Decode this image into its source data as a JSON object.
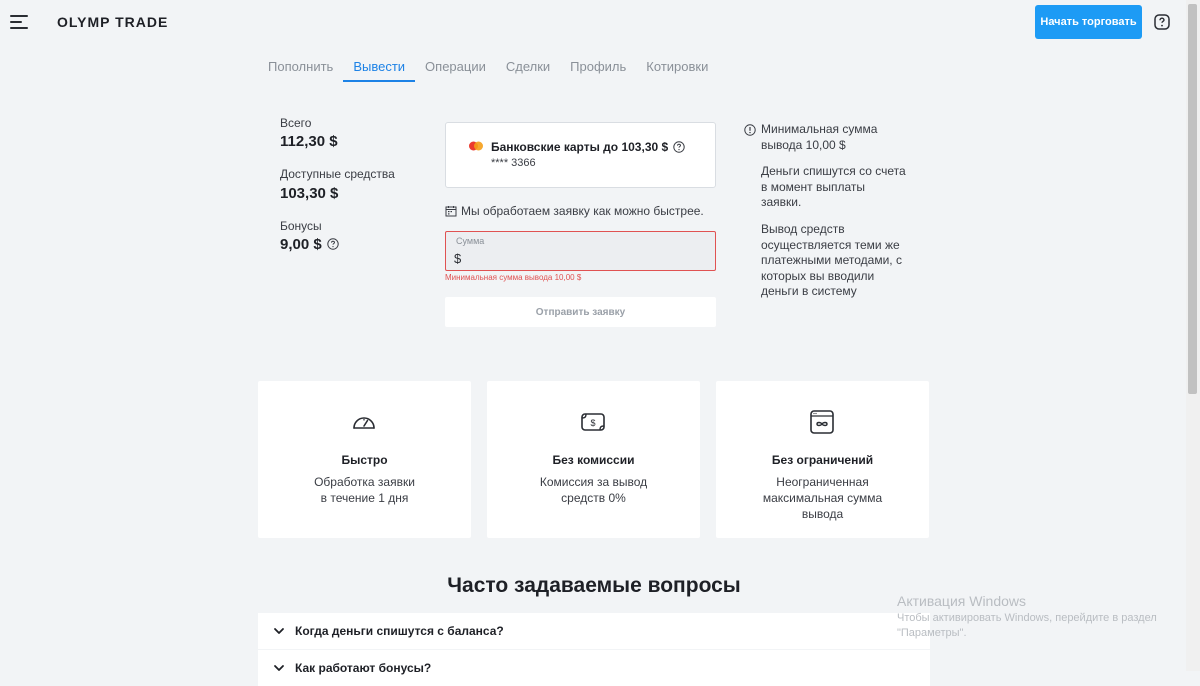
{
  "header": {
    "logo": "OLYMP TRADE",
    "cta_label": "Начать торговать"
  },
  "tabs": [
    {
      "label": "Пополнить",
      "active": false
    },
    {
      "label": "Вывести",
      "active": true
    },
    {
      "label": "Операции",
      "active": false
    },
    {
      "label": "Сделки",
      "active": false
    },
    {
      "label": "Профиль",
      "active": false
    },
    {
      "label": "Котировки",
      "active": false
    }
  ],
  "balances": {
    "total_label": "Всего",
    "total_value": "112,30 $",
    "available_label": "Доступные средства",
    "available_value": "103,30 $",
    "bonus_label": "Бонусы",
    "bonus_value": "9,00 $"
  },
  "withdraw": {
    "method_name": "Банковские карты до 103,30 $",
    "card_number": "**** 3366",
    "note": "Мы обработаем заявку как можно быстрее.",
    "amount_label": "Сумма",
    "amount_value": "$",
    "error": "Минимальная сумма вывода 10,00 $",
    "submit_label": "Отправить заявку"
  },
  "info": {
    "min_amount": "Минимальная сумма вывода 10,00 $",
    "debit_note": "Деньги спишутся со счета в момент выплаты заявки.",
    "methods_note": "Вывод средств осуществляется теми же платежными методами, с которых вы вводили деньги в систему"
  },
  "features": [
    {
      "title": "Быстро",
      "lines": [
        "Обработка заявки",
        "в течение 1 дня"
      ],
      "icon": "speedometer-icon"
    },
    {
      "title": "Без комиссии",
      "lines": [
        "Комиссия за вывод",
        "средств 0%"
      ],
      "icon": "cash-icon"
    },
    {
      "title": "Без ограничений",
      "lines": [
        "Неограниченная",
        "максимальная сумма",
        "вывода"
      ],
      "icon": "infinity-window-icon"
    }
  ],
  "faq": {
    "title": "Часто задаваемые вопросы",
    "items": [
      "Когда деньги спишутся с баланса?",
      "Как работают бонусы?"
    ]
  },
  "watermark": {
    "title": "Активация Windows",
    "line1": "Чтобы активировать Windows, перейдите в раздел",
    "line2": "\"Параметры\"."
  },
  "colors": {
    "accent": "#1d9bf5",
    "tab_active": "#1d82e6",
    "error": "#e05252",
    "background": "#f2f4f6"
  }
}
